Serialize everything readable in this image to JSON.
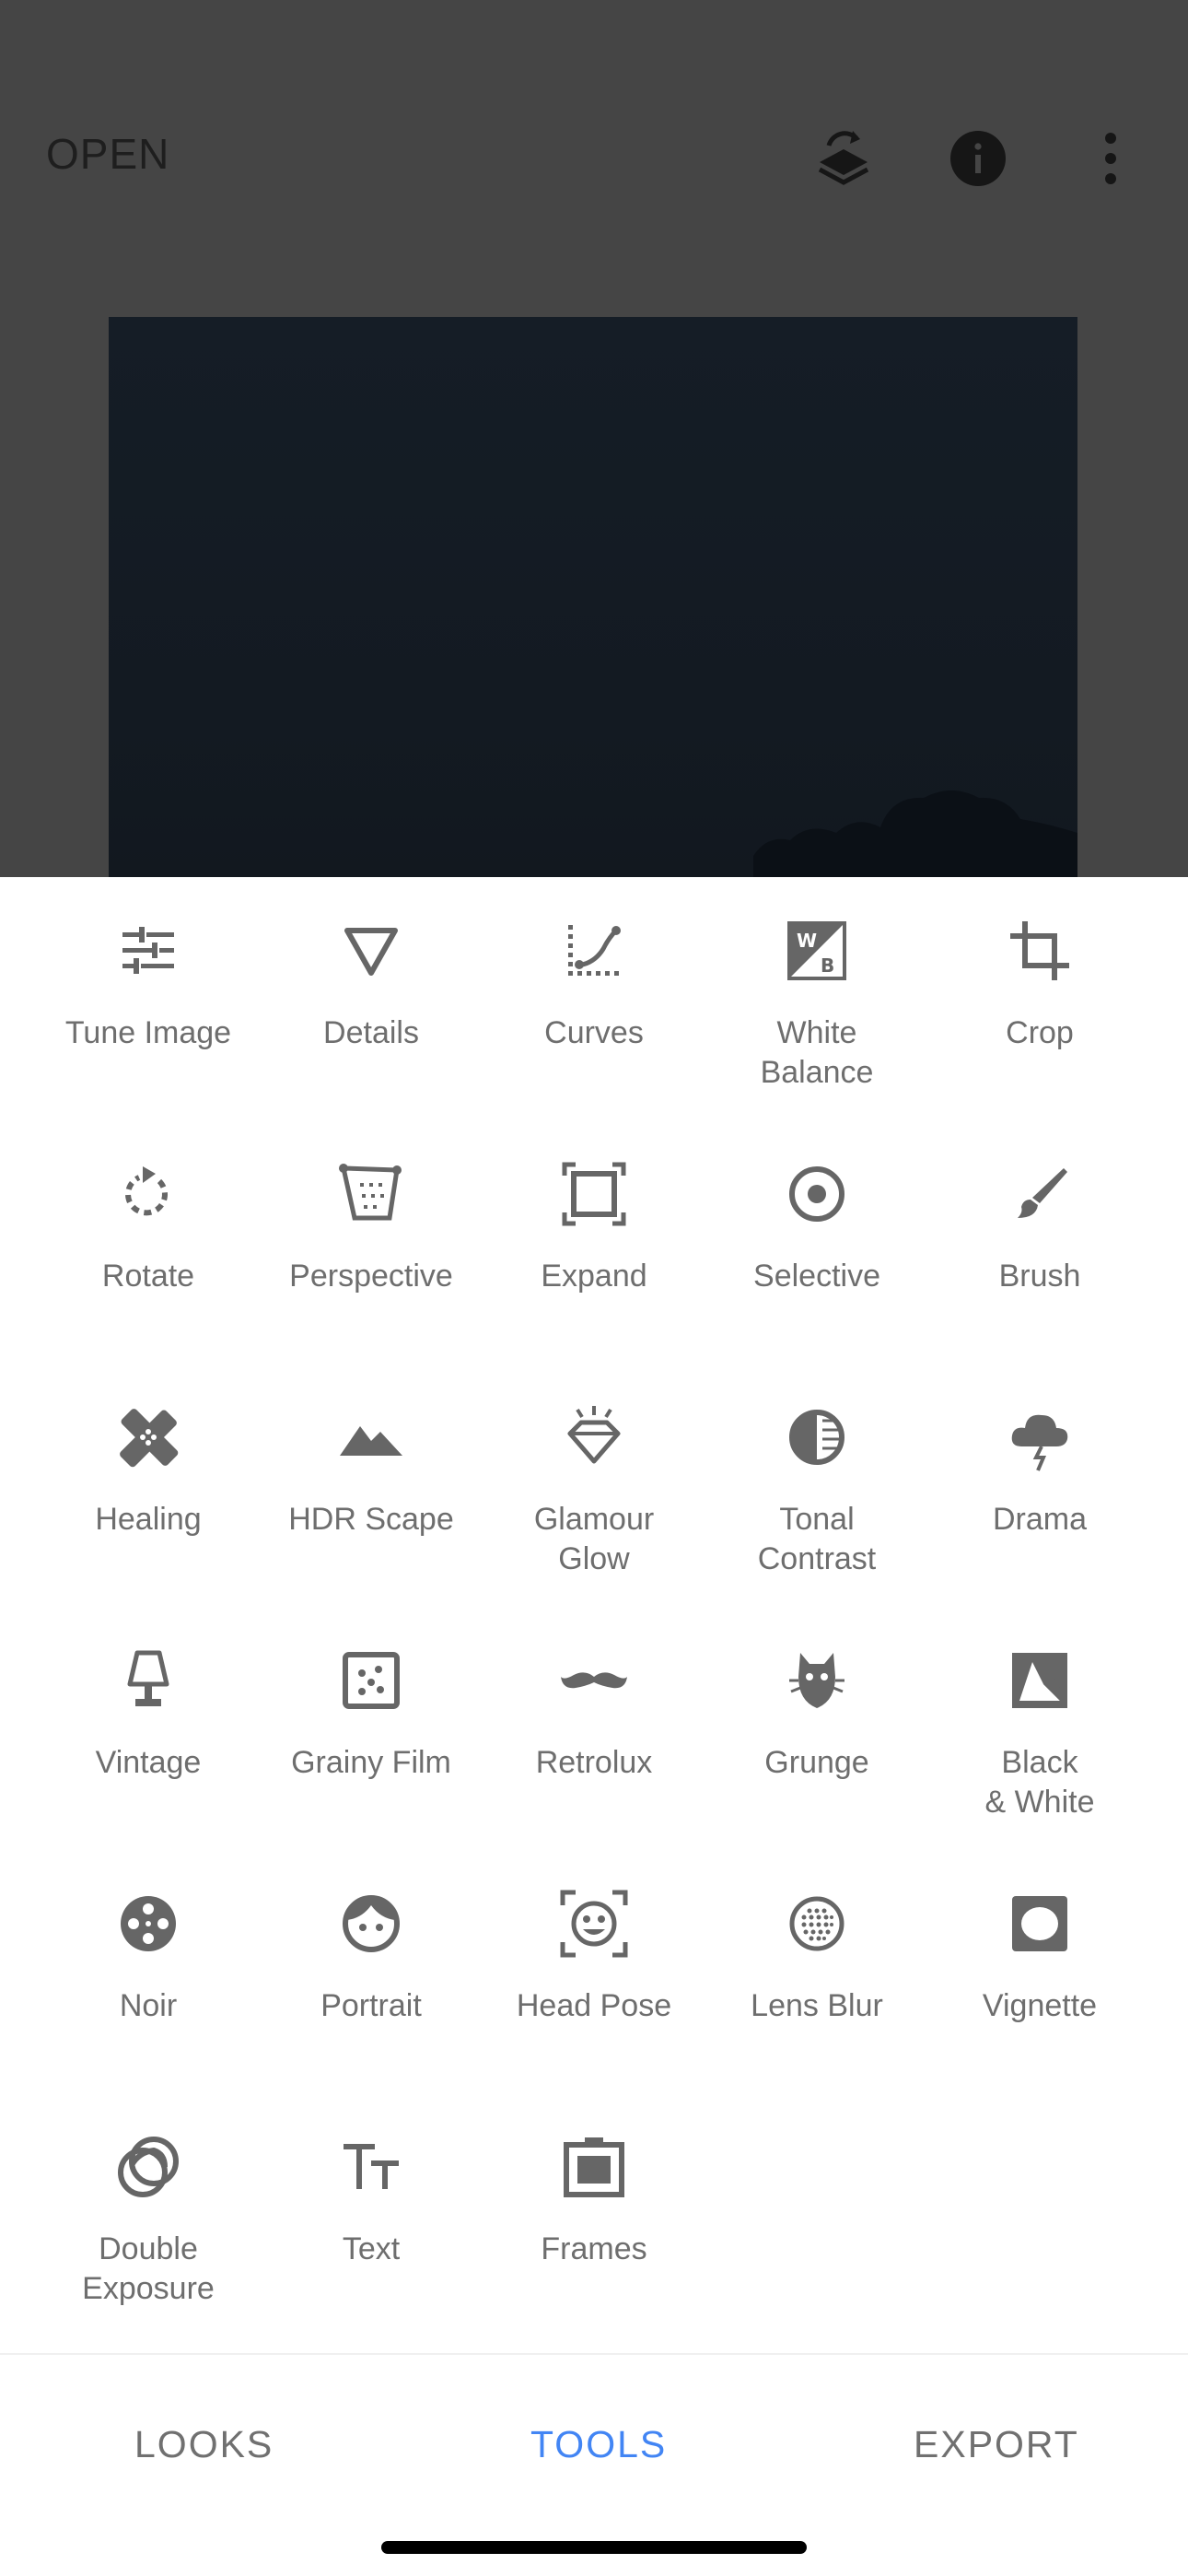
{
  "header": {
    "open_label": "OPEN",
    "icons": [
      "layers-revert-icon",
      "info-icon",
      "more-vert-icon"
    ]
  },
  "tools": [
    {
      "label": "Tune Image",
      "icon": "tune-icon"
    },
    {
      "label": "Details",
      "icon": "details-triangle-icon"
    },
    {
      "label": "Curves",
      "icon": "curves-icon"
    },
    {
      "label": "White\nBalance",
      "icon": "white-balance-icon"
    },
    {
      "label": "Crop",
      "icon": "crop-icon"
    },
    {
      "label": "Rotate",
      "icon": "rotate-icon"
    },
    {
      "label": "Perspective",
      "icon": "perspective-icon"
    },
    {
      "label": "Expand",
      "icon": "expand-icon"
    },
    {
      "label": "Selective",
      "icon": "selective-icon"
    },
    {
      "label": "Brush",
      "icon": "brush-icon"
    },
    {
      "label": "Healing",
      "icon": "healing-icon"
    },
    {
      "label": "HDR Scape",
      "icon": "hdr-scape-icon"
    },
    {
      "label": "Glamour\nGlow",
      "icon": "glamour-glow-icon"
    },
    {
      "label": "Tonal\nContrast",
      "icon": "tonal-contrast-icon"
    },
    {
      "label": "Drama",
      "icon": "drama-icon"
    },
    {
      "label": "Vintage",
      "icon": "vintage-icon"
    },
    {
      "label": "Grainy Film",
      "icon": "grainy-film-icon"
    },
    {
      "label": "Retrolux",
      "icon": "retrolux-icon"
    },
    {
      "label": "Grunge",
      "icon": "grunge-icon"
    },
    {
      "label": "Black\n& White",
      "icon": "black-white-icon"
    },
    {
      "label": "Noir",
      "icon": "noir-icon"
    },
    {
      "label": "Portrait",
      "icon": "portrait-icon"
    },
    {
      "label": "Head Pose",
      "icon": "head-pose-icon"
    },
    {
      "label": "Lens Blur",
      "icon": "lens-blur-icon"
    },
    {
      "label": "Vignette",
      "icon": "vignette-icon"
    },
    {
      "label": "Double\nExposure",
      "icon": "double-exposure-icon"
    },
    {
      "label": "Text",
      "icon": "text-icon"
    },
    {
      "label": "Frames",
      "icon": "frames-icon"
    }
  ],
  "bottom_nav": {
    "looks_label": "LOOKS",
    "tools_label": "TOOLS",
    "export_label": "EXPORT",
    "active": "TOOLS"
  },
  "colors": {
    "accent": "#4285f4",
    "icon": "#666666",
    "label": "#6e6e6e",
    "header_bg": "#454545"
  }
}
